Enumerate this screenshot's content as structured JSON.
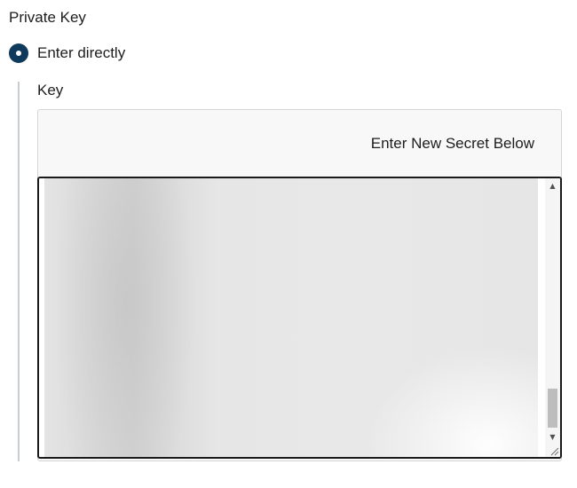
{
  "private_key": {
    "section_label": "Private Key",
    "option": {
      "label": "Enter directly",
      "selected": true
    },
    "key_field": {
      "label": "Key",
      "header_text": "Enter New Secret Below",
      "value_visible": false
    }
  },
  "colors": {
    "radio_accent": "#0f3a5c",
    "indent_line": "#c8cdd2",
    "panel_background": "#f8f8f8",
    "textarea_border": "#1a1a1a"
  },
  "icons": {
    "radio": "radio-selected-icon",
    "scroll_up": "scroll-up-arrow-icon",
    "scroll_down": "scroll-down-arrow-icon",
    "resize": "resize-grip-icon"
  }
}
